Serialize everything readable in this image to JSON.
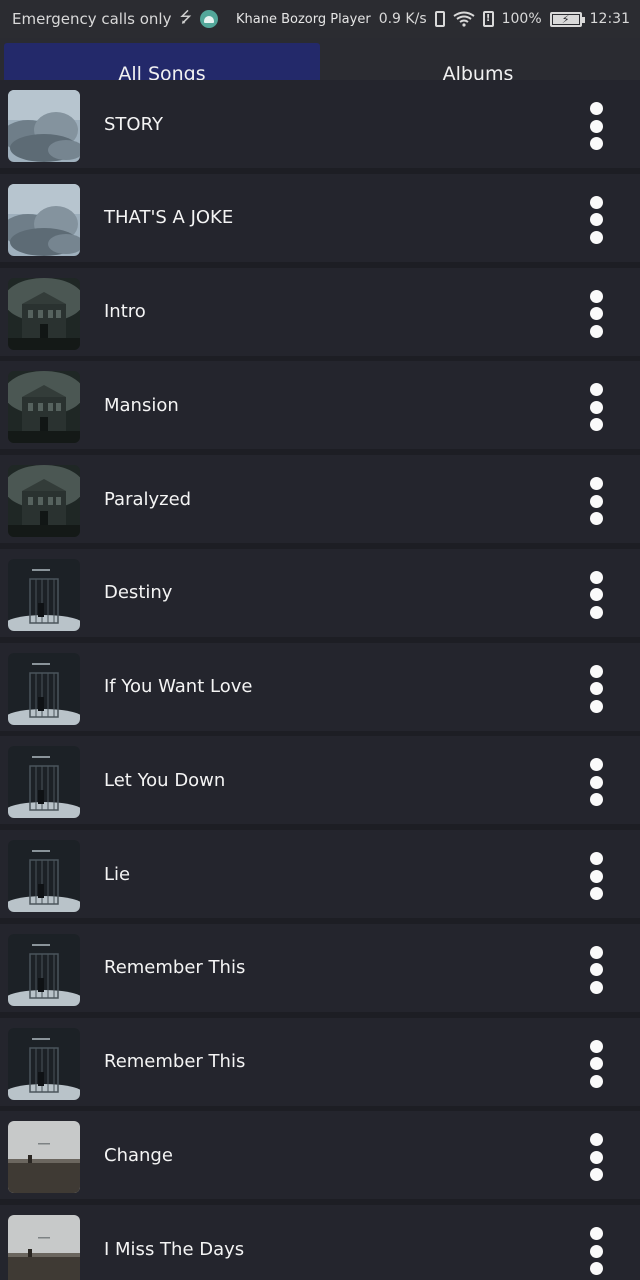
{
  "status_bar": {
    "carrier_text": "Emergency calls only",
    "usb_icon": "usb-icon",
    "android_icon": "android-debug-icon",
    "app_name": "Khane Bozorg Player",
    "net_speed": "0.9 K/s",
    "battery_percent": "100%",
    "time": "12:31"
  },
  "tabs": [
    {
      "label": "All Songs",
      "active": true
    },
    {
      "label": "Albums",
      "active": false
    }
  ],
  "songs": [
    {
      "title": "STORY",
      "art": "cloud-sky-cover"
    },
    {
      "title": "THAT'S A JOKE",
      "art": "cloud-sky-cover"
    },
    {
      "title": "Intro",
      "art": "mansion-cover"
    },
    {
      "title": "Mansion",
      "art": "mansion-cover"
    },
    {
      "title": "Paralyzed",
      "art": "mansion-cover"
    },
    {
      "title": "Destiny",
      "art": "cage-cover"
    },
    {
      "title": "If You Want Love",
      "art": "cage-cover"
    },
    {
      "title": "Let You Down",
      "art": "cage-cover"
    },
    {
      "title": "Lie",
      "art": "cage-cover"
    },
    {
      "title": "Remember This",
      "art": "cage-cover"
    },
    {
      "title": "Remember This",
      "art": "cage-cover"
    },
    {
      "title": "Change",
      "art": "field-cover"
    },
    {
      "title": "I Miss The Days",
      "art": "field-cover"
    }
  ],
  "colors": {
    "background": "#1d1e24",
    "row_background": "#24252d",
    "tab_active": "#23296a",
    "tab_bar": "#2a2b31",
    "status_bar": "#2b2c31"
  }
}
